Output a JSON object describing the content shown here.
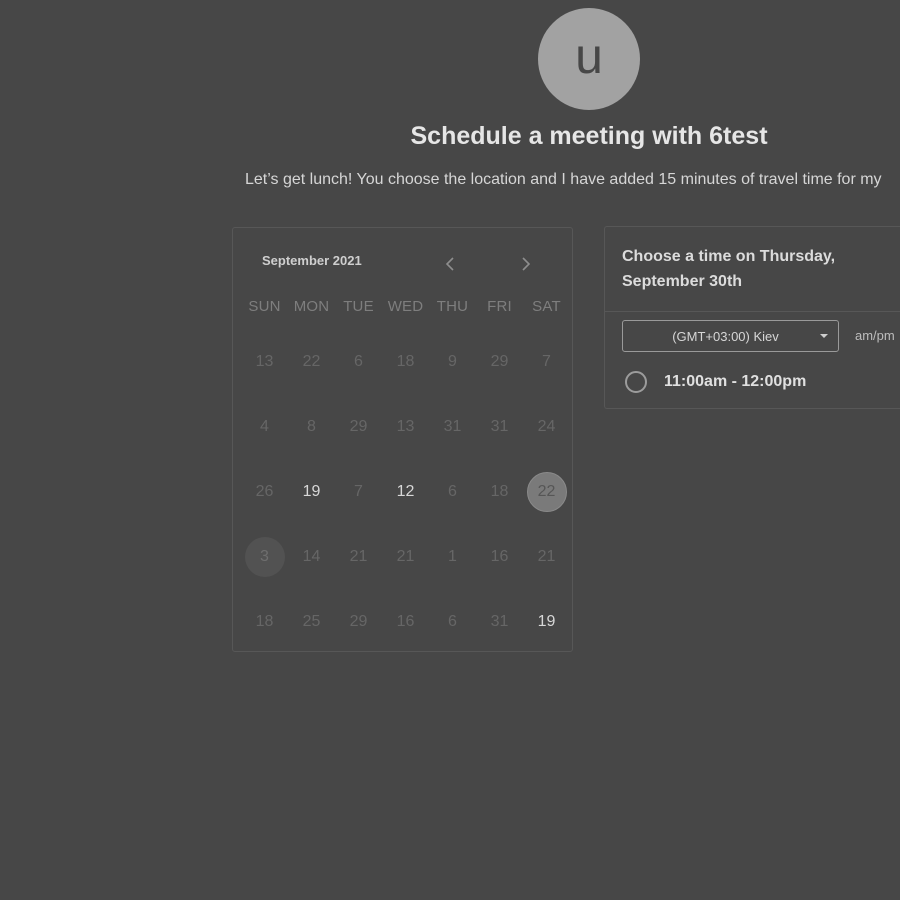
{
  "host": {
    "avatar_initial": "u",
    "title": "Schedule a meeting with 6test",
    "description": "Let’s get lunch! You choose the location and I have added 15 minutes of travel time for my"
  },
  "calendar": {
    "month_label": "September 2021",
    "prev_icon": "chevron-left-icon",
    "next_icon": "chevron-right-icon",
    "weekdays": [
      "SUN",
      "MON",
      "TUE",
      "WED",
      "THU",
      "FRI",
      "SAT"
    ],
    "weeks": [
      [
        {
          "d": "13",
          "s": "muted"
        },
        {
          "d": "22",
          "s": "muted"
        },
        {
          "d": "6",
          "s": "muted"
        },
        {
          "d": "18",
          "s": "muted"
        },
        {
          "d": "9",
          "s": "muted"
        },
        {
          "d": "29",
          "s": "muted"
        },
        {
          "d": "7",
          "s": "muted"
        }
      ],
      [
        {
          "d": "4",
          "s": "muted"
        },
        {
          "d": "8",
          "s": "muted"
        },
        {
          "d": "29",
          "s": "muted"
        },
        {
          "d": "13",
          "s": "muted"
        },
        {
          "d": "31",
          "s": "muted"
        },
        {
          "d": "31",
          "s": "muted"
        },
        {
          "d": "24",
          "s": "muted"
        }
      ],
      [
        {
          "d": "26",
          "s": "muted"
        },
        {
          "d": "19",
          "s": "available"
        },
        {
          "d": "7",
          "s": "muted"
        },
        {
          "d": "12",
          "s": "available"
        },
        {
          "d": "6",
          "s": "muted"
        },
        {
          "d": "18",
          "s": "muted"
        },
        {
          "d": "22",
          "s": "selected"
        }
      ],
      [
        {
          "d": "3",
          "s": "today"
        },
        {
          "d": "14",
          "s": "muted"
        },
        {
          "d": "21",
          "s": "muted"
        },
        {
          "d": "21",
          "s": "muted"
        },
        {
          "d": "1",
          "s": "muted"
        },
        {
          "d": "16",
          "s": "muted"
        },
        {
          "d": "21",
          "s": "muted"
        }
      ],
      [
        {
          "d": "18",
          "s": "muted"
        },
        {
          "d": "25",
          "s": "muted"
        },
        {
          "d": "29",
          "s": "muted"
        },
        {
          "d": "16",
          "s": "muted"
        },
        {
          "d": "6",
          "s": "muted"
        },
        {
          "d": "31",
          "s": "muted"
        },
        {
          "d": "19",
          "s": "available"
        }
      ]
    ]
  },
  "time_picker": {
    "heading": "Choose a time on Thursday, September 30th",
    "timezone": "(GMT+03:00) Kiev",
    "format_label": "am/pm",
    "slots": [
      {
        "label": "11:00am - 12:00pm"
      }
    ]
  }
}
